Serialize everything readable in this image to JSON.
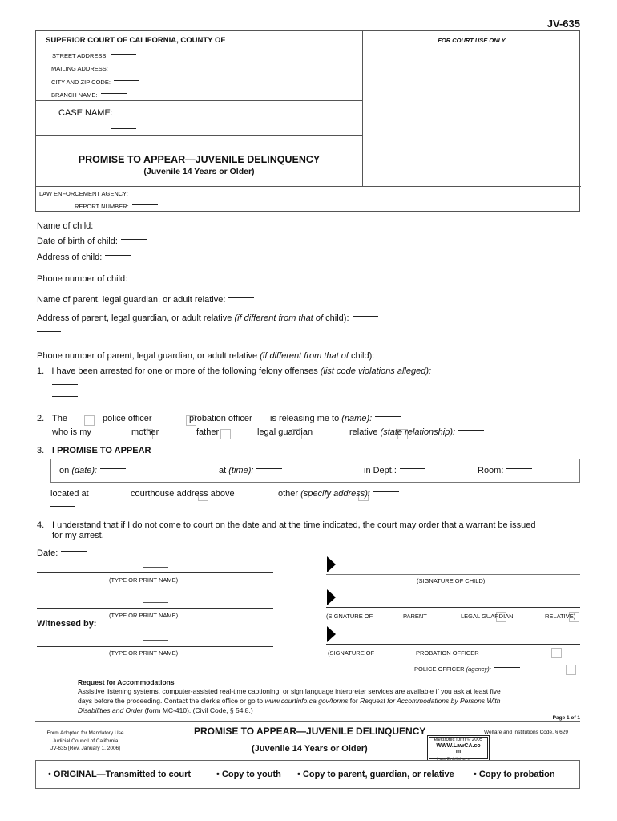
{
  "form_number": "JV-635",
  "caption": {
    "court_label": "SUPERIOR COURT OF CALIFORNIA, COUNTY OF",
    "street_address_label": "STREET ADDRESS:",
    "mailing_address_label": "MAILING ADDRESS:",
    "city_zip_label": "CITY AND ZIP CODE:",
    "branch_name_label": "BRANCH NAME:",
    "case_name_label": "CASE NAME:",
    "court_use_label": "FOR COURT USE ONLY",
    "title": "PROMISE TO APPEAR—JUVENILE DELINQUENCY",
    "subtitle": "(Juvenile 14 Years or Older)",
    "law_enforcement_label": "LAW ENFORCEMENT AGENCY:",
    "report_number_label": "REPORT NUMBER:"
  },
  "child_info": {
    "name_label": "Name of child:",
    "dob_label": "Date of birth of child:",
    "address_label": "Address of child:",
    "phone_label": "Phone number of child:",
    "parent_name_label": "Name of parent, legal guardian, or adult relative:",
    "parent_address_label": "Address of parent, legal guardian, or adult relative",
    "parent_address_note": "(if different from that of",
    "parent_address_note_end": "child):",
    "parent_phone_label": "Phone number of parent, legal guardian, or adult relative",
    "parent_phone_note": "(if different from that of",
    "parent_phone_note_end": "child):"
  },
  "item1": {
    "number": "1.",
    "text": "I have been arrested for one or more of the following felony offenses",
    "note": "(list code violations alleged):"
  },
  "item2": {
    "number": "2.",
    "the": "The",
    "police_officer": "police officer",
    "probation_officer": "probation officer",
    "releasing_text": "is releasing me to",
    "name_note": "(name):",
    "who_is_my": "who is my",
    "mother": "mother",
    "father": "father",
    "legal_guardian": "legal guardian",
    "relative": "relative",
    "relationship_note": "(state relationship):"
  },
  "item3": {
    "number": "3.",
    "heading": "I PROMISE TO APPEAR",
    "on_label": "on",
    "date_note": "(date):",
    "at_label": "at",
    "time_note": "(time):",
    "dept_label": "in Dept.:",
    "room_label": "Room:",
    "located_at": "located at",
    "courthouse_option": "courthouse address above",
    "other_option": "other",
    "specify_note": "(specify address):"
  },
  "item4": {
    "number": "4.",
    "line1": "I understand that if I do not come to court on the date and at the time indicated, the court may order that a warrant be issued",
    "line2": "for my arrest."
  },
  "signatures": {
    "date_label": "Date:",
    "print_name_label": "(TYPE OR PRINT NAME)",
    "sig_child_label": "(SIGNATURE OF CHILD)",
    "sig_of": "(SIGNATURE OF",
    "parent": "PARENT",
    "legal_guardian": "LEGAL GUARDIAN",
    "relative": "RELATIVE)",
    "witnessed_by": "Witnessed by:",
    "probation_officer": "PROBATION OFFICER",
    "police_officer": "POLICE OFFICER",
    "agency_note": "(agency):"
  },
  "accommodations": {
    "heading": "Request for Accommodations",
    "line1": "Assistive listening systems, computer-assisted real-time captioning, or sign language interpreter services are available if you ask at least five",
    "line2a": "days before the proceeding.  Contact the clerk's office or go to",
    "url": "www.courtinfo.ca.gov/forms",
    "line2b": "for",
    "line2c": "Request for Accommodations by Persons With",
    "line3a": "Disabilities and Order",
    "line3b": "(form MC-410).  (Civil Code, § 54.8.)"
  },
  "footer": {
    "page": "Page 1 of 1",
    "adopted_line1": "Form Adopted for Mandatory Use",
    "adopted_line2": "Judicial Council of California",
    "adopted_line3": "JV-635 [Rev. January 1, 2006]",
    "title": "PROMISE TO APPEAR—JUVENILE DELINQUENCY",
    "subtitle": "(Juvenile 14 Years or Older)",
    "code": "Welfare and Institutions Code, § 629",
    "lawca_line1": "electronic form © 2005",
    "lawca_line2": "WWW.LawCA.co",
    "lawca_line3": "m",
    "lawca_line4": "Law Publishers"
  },
  "copies": {
    "original": "• ORIGINAL—Transmitted to court",
    "youth": "• Copy to youth",
    "parent": "• Copy to parent, guardian, or relative",
    "probation": "• Copy to probation"
  }
}
